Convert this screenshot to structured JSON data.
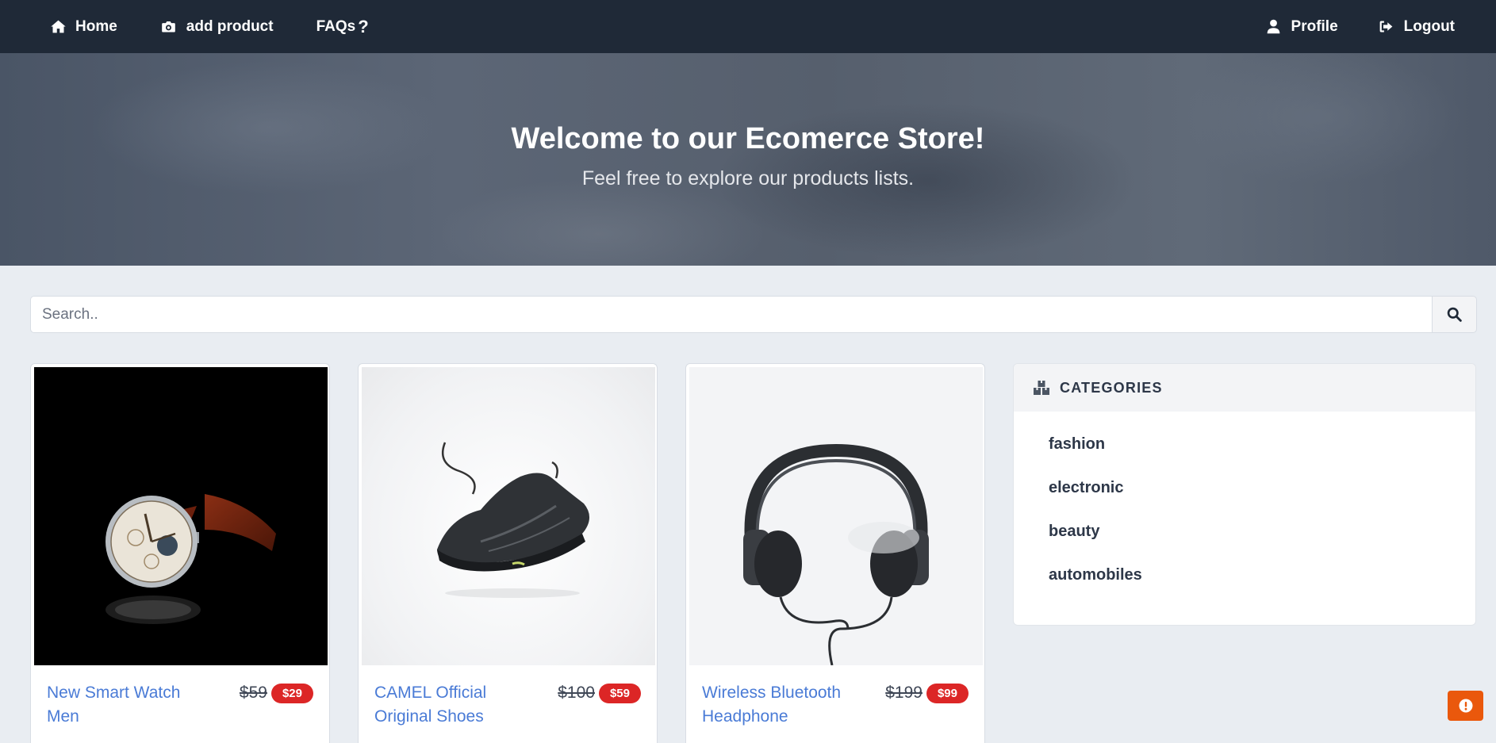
{
  "nav": {
    "home": "Home",
    "add_product": "add product",
    "faqs": "FAQs",
    "profile": "Profile",
    "logout": "Logout"
  },
  "hero": {
    "title": "Welcome to our Ecomerce Store!",
    "subtitle": "Feel free to explore our products lists."
  },
  "search": {
    "placeholder": "Search.."
  },
  "products": [
    {
      "title": "New Smart Watch Men",
      "old_price": "$59",
      "new_price": "$29",
      "image_icon": "wristwatch"
    },
    {
      "title": "CAMEL Official Original Shoes",
      "old_price": "$100",
      "new_price": "$59",
      "image_icon": "sneaker"
    },
    {
      "title": "Wireless Bluetooth Headphone",
      "old_price": "$199",
      "new_price": "$99",
      "image_icon": "headphones"
    }
  ],
  "categories": {
    "title": "CATEGORIES",
    "items": [
      "fashion",
      "electronic",
      "beauty",
      "automobiles"
    ]
  },
  "icons": {
    "home": "home-icon",
    "add_product": "camera-icon",
    "faqs": "question-icon",
    "profile": "user-icon",
    "logout": "sign-out-icon",
    "search": "search-icon",
    "categories": "boxes-icon",
    "feedback": "exclamation-icon"
  },
  "colors": {
    "navbar": "#1f2937",
    "accent_link": "#4a7bd6",
    "price_badge": "#dc2626",
    "float_button": "#ea580c"
  }
}
